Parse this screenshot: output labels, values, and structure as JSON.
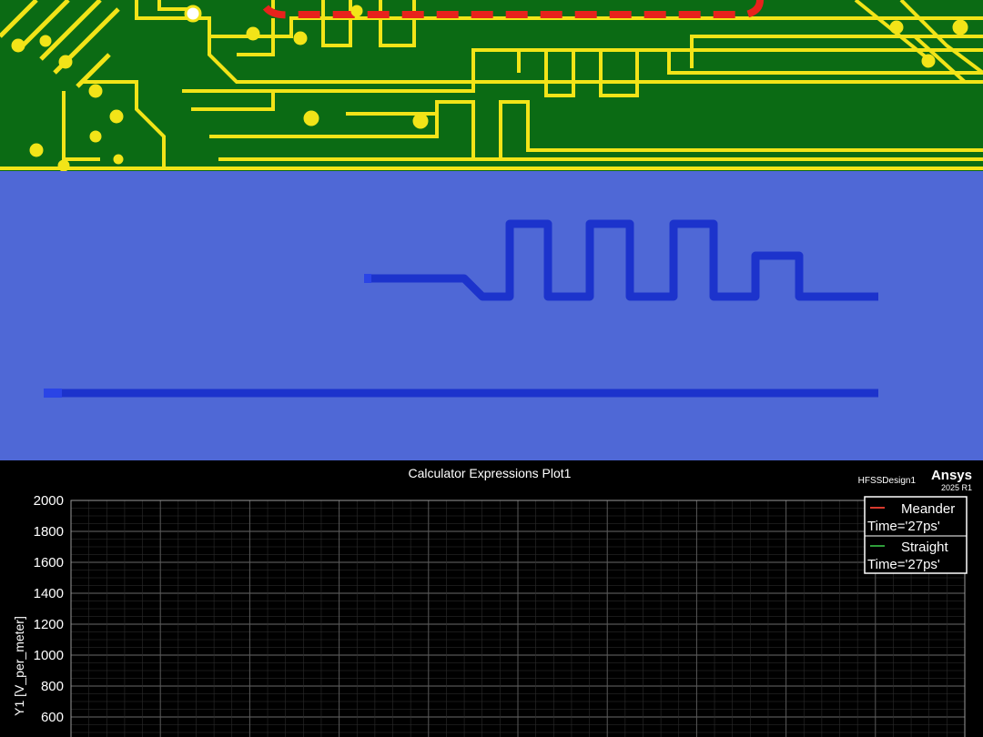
{
  "chart_data": {
    "type": "line",
    "title": "Calculator Expressions Plot1",
    "design_name": "HFSSDesign1",
    "brand": "Ansys",
    "version": "2025 R1",
    "ylabel": "Y1 [V_per_meter]",
    "yticks": [
      600,
      800,
      1000,
      1200,
      1400,
      1600,
      1800,
      2000
    ],
    "ylim": [
      500,
      2000
    ],
    "grid": true,
    "legend_position": "top-right",
    "series": [
      {
        "name": "Meander",
        "subtitle": "Time='27ps'",
        "color": "#d83a2e",
        "values": []
      },
      {
        "name": "Straight",
        "subtitle": "Time='27ps'",
        "color": "#2e9e3a",
        "values": []
      }
    ]
  },
  "colors": {
    "pcb_board": "#0b6b14",
    "pcb_trace": "#f2e418",
    "pcb_dash": "#e8221c",
    "model_substrate": "#4f68d6",
    "model_trace": "#1c33cc",
    "plot_bg": "#000000",
    "plot_grid": "#4a4a4a",
    "plot_axis_text": "#ffffff"
  }
}
